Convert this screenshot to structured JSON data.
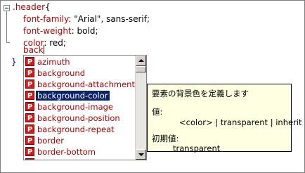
{
  "code": {
    "selector": ".header",
    "open_brace": "{",
    "lines": [
      {
        "prop": "font-family",
        "value": " \"Arial\", sans-serif;"
      },
      {
        "prop": "font-weight",
        "value": " bold;"
      },
      {
        "prop": "color",
        "value": " red;"
      }
    ],
    "typing": "back",
    "close_brace": "}"
  },
  "autocomplete": {
    "icon_letter": "P",
    "selected_index": 3,
    "items": [
      "azimuth",
      "background",
      "background-attachment",
      "background-color",
      "background-image",
      "background-position",
      "background-repeat",
      "border",
      "border-bottom",
      "border-bottom-color"
    ]
  },
  "tooltip": {
    "description": "要素の背景色を定義します",
    "value_label": "値:",
    "value": "<color> | transparent | inherit",
    "initial_label": "初期値:",
    "initial_value": "transparent"
  }
}
